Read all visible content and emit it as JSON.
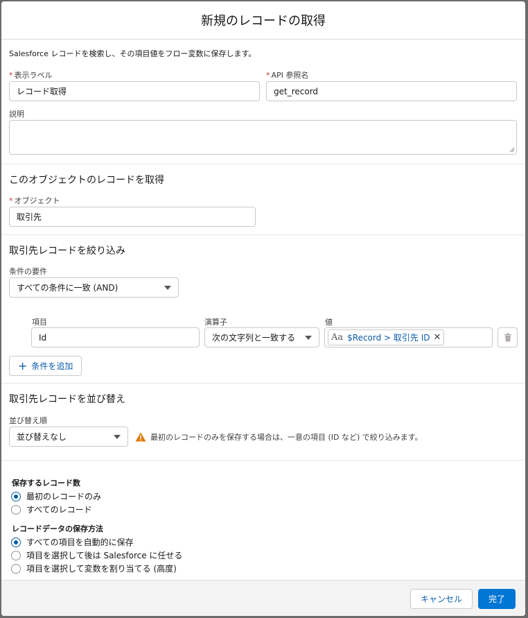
{
  "modal": {
    "title": "新規のレコードの取得",
    "description": "Salesforce レコードを検索し、その項目値をフロー変数に保存します。"
  },
  "fields": {
    "label": {
      "label": "表示ラベル",
      "required_mark": "*",
      "value": "レコード取得"
    },
    "api_name": {
      "label": "API 参照名",
      "required_mark": "*",
      "value": "get_record"
    },
    "description": {
      "label": "説明",
      "value": ""
    }
  },
  "object_section": {
    "title": "このオブジェクトのレコードを取得",
    "object_label": "オブジェクト",
    "required_mark": "*",
    "object_value": "取引先"
  },
  "filter_section": {
    "title": "取引先レコードを絞り込み",
    "condition_requirement_label": "条件の要件",
    "condition_requirement_value": "すべての条件に一致 (AND)",
    "columns": {
      "field": "項目",
      "operator": "演算子",
      "value": "値"
    },
    "row": {
      "field": "Id",
      "operator": "次の文字列と一致する",
      "value_icon": "Aa",
      "value_pill": "$Record > 取引先 ID",
      "remove": "✕"
    },
    "add_condition": "条件を追加"
  },
  "sort_section": {
    "title": "取引先レコードを並び替え",
    "sort_order_label": "並び替え順",
    "sort_order_value": "並び替えなし",
    "warning": "最初のレコードのみを保存する場合は、一意の項目 (ID など) で絞り込みます。"
  },
  "store_count": {
    "title": "保存するレコード数",
    "options": [
      {
        "label": "最初のレコードのみ",
        "checked": true
      },
      {
        "label": "すべてのレコード",
        "checked": false
      }
    ]
  },
  "store_method": {
    "title": "レコードデータの保存方法",
    "options": [
      {
        "label": "すべての項目を自動的に保存",
        "checked": true
      },
      {
        "label": "項目を選択して後は Salesforce に任せる",
        "checked": false
      },
      {
        "label": "項目を選択して変数を割り当てる (高度)",
        "checked": false
      }
    ]
  },
  "footer": {
    "cancel": "キャンセル",
    "done": "完了"
  },
  "colors": {
    "brand": "#0176d3",
    "link": "#0b5cab",
    "required": "#c23934",
    "warning": "#dd7a01"
  },
  "icons": [
    "warning-icon",
    "trash-icon",
    "plus-icon",
    "text-type-icon",
    "close-icon",
    "chevron-down-icon"
  ]
}
